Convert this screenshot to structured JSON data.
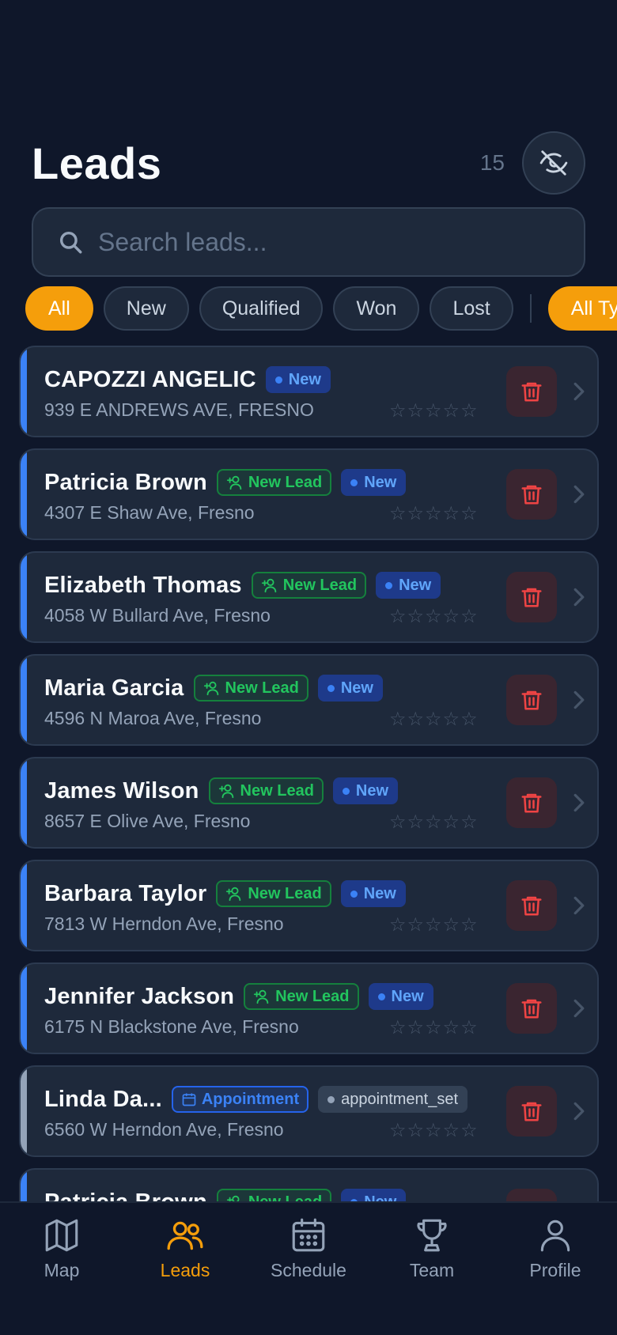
{
  "header": {
    "title": "Leads",
    "count": "15"
  },
  "search": {
    "placeholder": "Search leads..."
  },
  "filters": {
    "status": [
      "All",
      "New",
      "Qualified",
      "Won",
      "Lost"
    ],
    "type": "All Types"
  },
  "colors": {
    "accent": "#f59e0b",
    "new_bar": "#3b82f6",
    "appointment_bar": "#94a3b8",
    "delete": "#ef4444"
  },
  "leads": [
    {
      "name": "CAPOZZI ANGELIC",
      "address": "939 E ANDREWS AVE, FRESNO",
      "tag": "",
      "status": "New",
      "rating": 0
    },
    {
      "name": "Patricia Brown",
      "address": "4307 E Shaw Ave, Fresno",
      "tag": "New Lead",
      "status": "New",
      "rating": 0
    },
    {
      "name": "Elizabeth Thomas",
      "address": "4058 W Bullard Ave, Fresno",
      "tag": "New Lead",
      "status": "New",
      "rating": 0
    },
    {
      "name": "Maria Garcia",
      "address": "4596 N Maroa Ave, Fresno",
      "tag": "New Lead",
      "status": "New",
      "rating": 0
    },
    {
      "name": "James Wilson",
      "address": "8657 E Olive Ave, Fresno",
      "tag": "New Lead",
      "status": "New",
      "rating": 0
    },
    {
      "name": "Barbara Taylor",
      "address": "7813 W Herndon Ave, Fresno",
      "tag": "New Lead",
      "status": "New",
      "rating": 0
    },
    {
      "name": "Jennifer Jackson",
      "address": "6175 N Blackstone Ave, Fresno",
      "tag": "New Lead",
      "status": "New",
      "rating": 0
    },
    {
      "name": "Linda Da...",
      "address": "6560 W Herndon Ave, Fresno",
      "tag": "Appointment",
      "status": "appointment_set",
      "rating": 0
    },
    {
      "name": "Patricia Brown",
      "address": "",
      "tag": "New Lead",
      "status": "New",
      "rating": 0
    }
  ],
  "stars": "☆☆☆☆☆",
  "nav": [
    {
      "label": "Map",
      "icon": "map-icon"
    },
    {
      "label": "Leads",
      "icon": "users-icon"
    },
    {
      "label": "Schedule",
      "icon": "calendar-icon"
    },
    {
      "label": "Team",
      "icon": "trophy-icon"
    },
    {
      "label": "Profile",
      "icon": "user-icon"
    }
  ]
}
